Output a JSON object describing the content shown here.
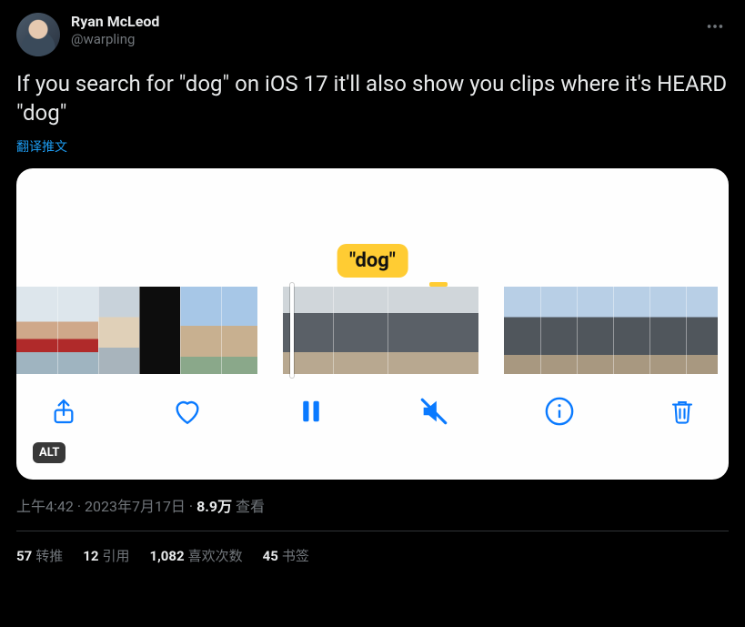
{
  "author": {
    "display_name": "Ryan McLeod",
    "handle": "@warpling"
  },
  "tweet_text": "If you search for \"dog\" on iOS 17 it'll also show you clips where it's HEARD \"dog\"",
  "translate_label": "翻译推文",
  "media": {
    "caption_bubble": "\"dog\"",
    "alt_badge": "ALT",
    "toolbar": {
      "share": "share",
      "like": "like",
      "pause": "pause",
      "mute": "mute",
      "info": "info",
      "delete": "delete"
    }
  },
  "meta": {
    "time": "上午4:42",
    "sep1": " · ",
    "date": "2023年7月17日",
    "sep2": " · ",
    "views_count": "8.9万",
    "views_label": " 查看"
  },
  "stats": {
    "retweets": {
      "count": "57",
      "label": "转推"
    },
    "quotes": {
      "count": "12",
      "label": "引用"
    },
    "likes": {
      "count": "1,082",
      "label": "喜欢次数"
    },
    "bookmarks": {
      "count": "45",
      "label": "书签"
    }
  }
}
